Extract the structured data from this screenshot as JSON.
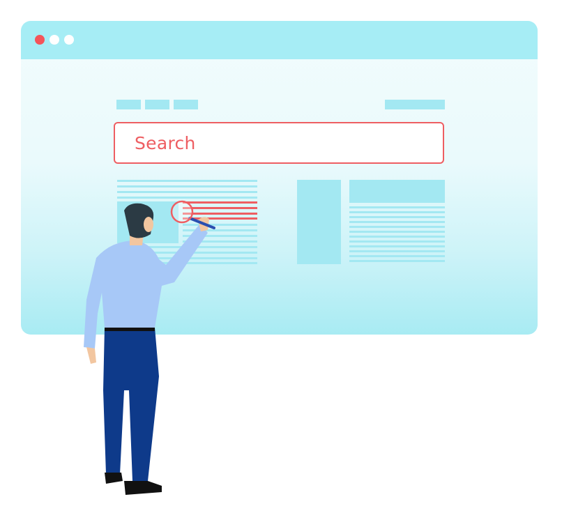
{
  "search": {
    "placeholder": "Search"
  },
  "colors": {
    "window_bar": "#a6edf5",
    "window_body": "#eafafc",
    "accent_red": "#ee5e62",
    "content_blue": "#a3e8f2",
    "shirt": "#a7c8f7",
    "pants": "#0e3a8a",
    "hair": "#2b3a44"
  },
  "window_controls": [
    {
      "name": "close-dot",
      "color": "#f4545a"
    },
    {
      "name": "minimize-dot",
      "color": "#ffffff"
    },
    {
      "name": "maximize-dot",
      "color": "#ffffff"
    }
  ],
  "icons": [
    "magnifier-icon"
  ]
}
